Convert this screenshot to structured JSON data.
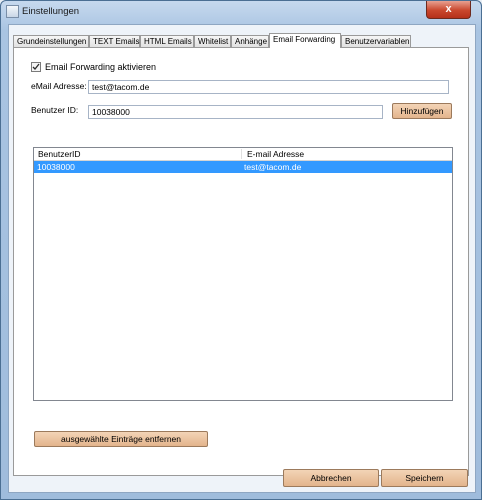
{
  "window": {
    "title": "Einstellungen",
    "close_glyph": "x"
  },
  "tabs": [
    {
      "label": "Grundeinstellungen"
    },
    {
      "label": "TEXT Emails"
    },
    {
      "label": "HTML Emails"
    },
    {
      "label": "Whitelist"
    },
    {
      "label": "Anhänge"
    },
    {
      "label": "Email Forwarding",
      "active": true
    },
    {
      "label": "Benutzervariablen"
    }
  ],
  "forwarding": {
    "enable_label": "Email Forwarding aktivieren",
    "enable_checked": true,
    "email_label": "eMail Adresse:",
    "email_value": "test@tacom.de",
    "userid_label": "Benutzer ID:",
    "userid_value": "10038000",
    "add_button": "Hinzufügen"
  },
  "list": {
    "columns": [
      "BenutzerID",
      "E-mail Adresse"
    ],
    "rows": [
      {
        "userid": "10038000",
        "email": "test@tacom.de",
        "selected": true
      }
    ]
  },
  "remove_button": "ausgewählte Einträge entfernen",
  "footer": {
    "cancel": "Abbrechen",
    "save": "Speichern"
  },
  "colors": {
    "selection": "#3399ff",
    "button_accent": "#e8bc94",
    "close_button": "#c9472d"
  }
}
